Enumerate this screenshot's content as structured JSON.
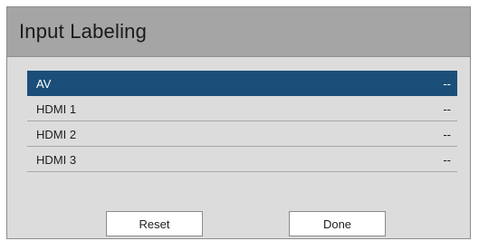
{
  "dialog": {
    "title": "Input Labeling"
  },
  "inputs": [
    {
      "label": "AV",
      "value": "--",
      "selected": true
    },
    {
      "label": "HDMI 1",
      "value": "--",
      "selected": false
    },
    {
      "label": "HDMI 2",
      "value": "--",
      "selected": false
    },
    {
      "label": "HDMI 3",
      "value": "--",
      "selected": false
    }
  ],
  "buttons": {
    "reset_label": "Reset",
    "done_label": "Done"
  },
  "colors": {
    "selected_row": "#1b4f79",
    "title_bar": "#a5a5a5",
    "dialog_bg": "#dcdcdc"
  }
}
